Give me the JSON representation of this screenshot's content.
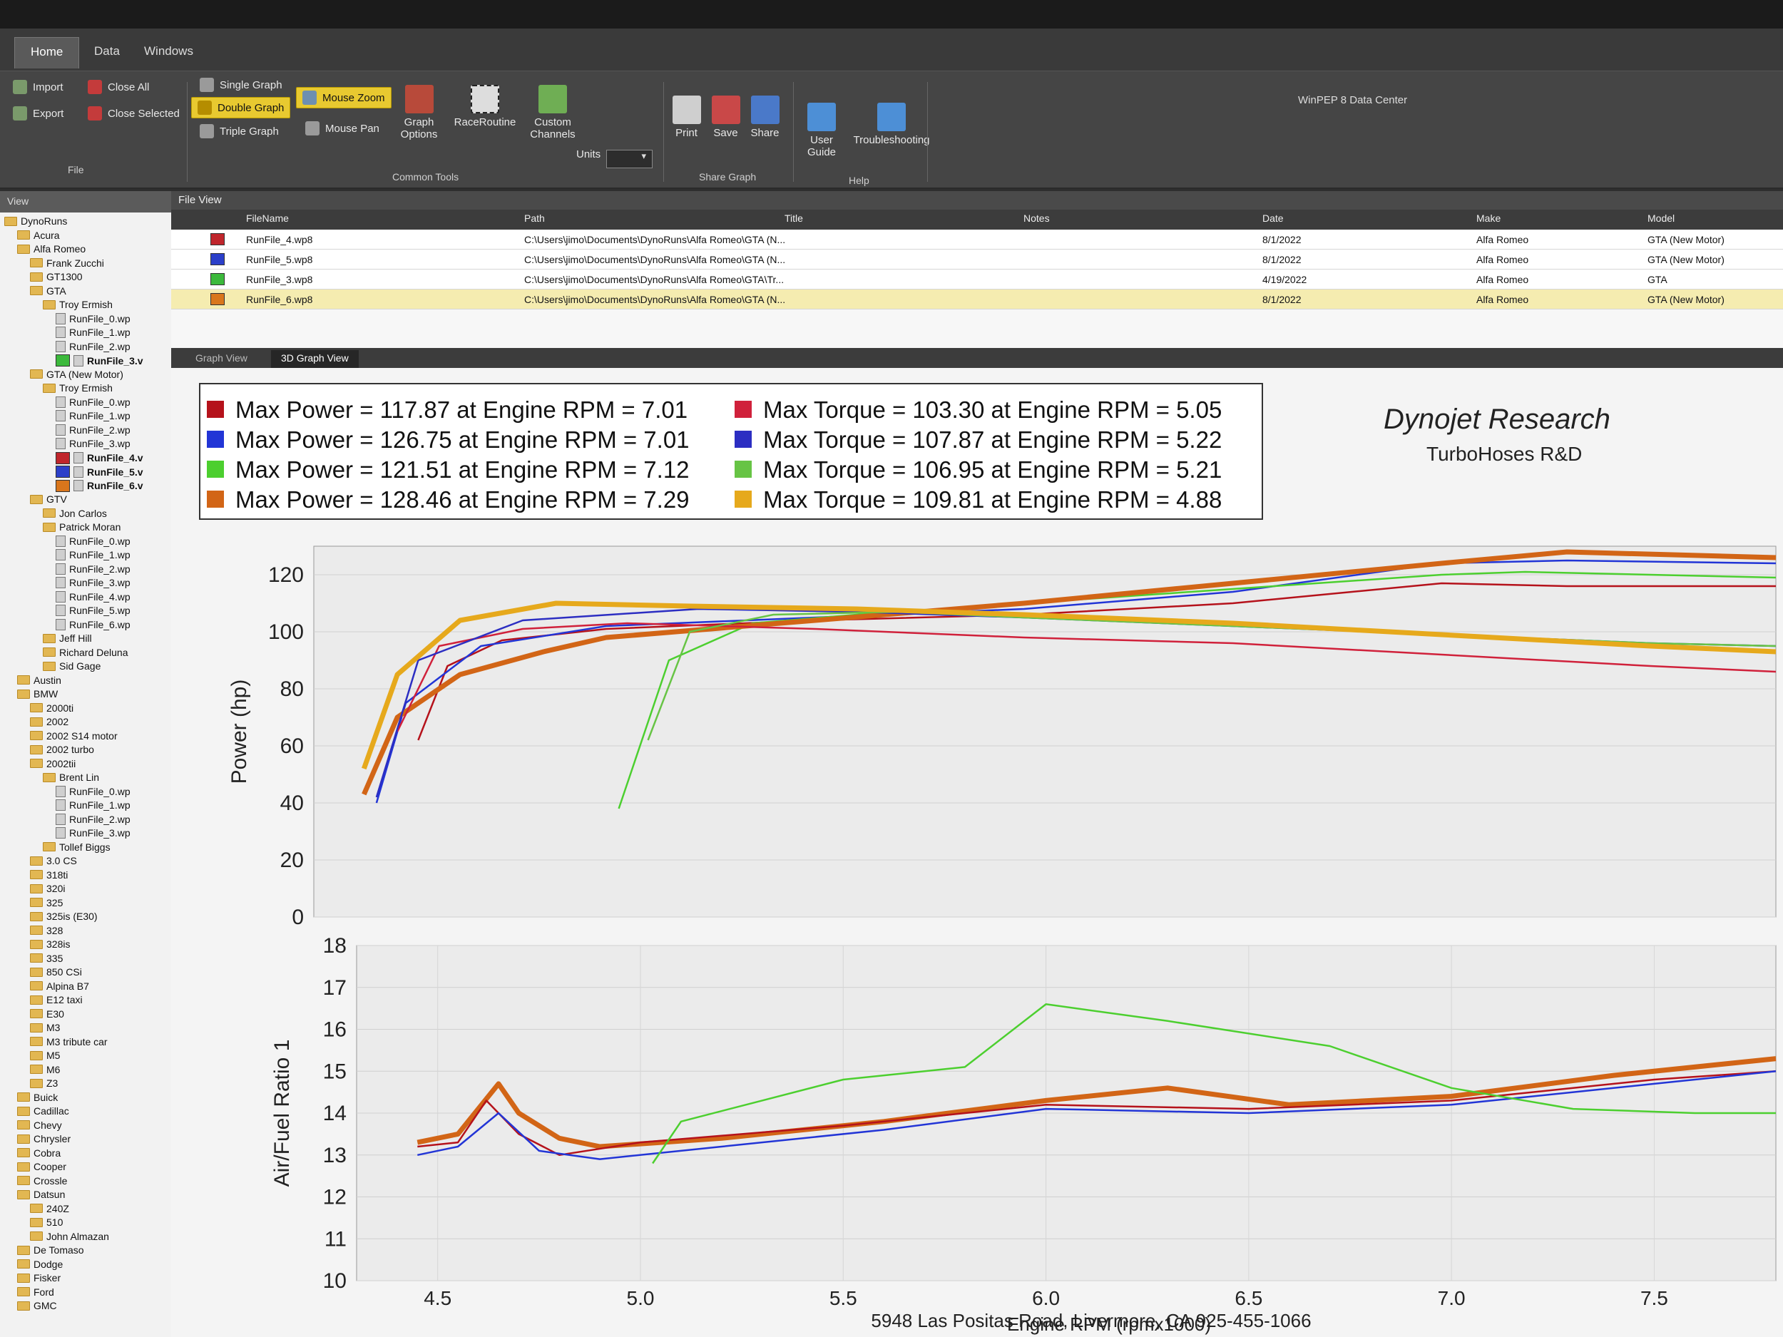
{
  "app": {
    "title": "WinPEP 8 Data Center",
    "tabs": [
      "Home",
      "Data",
      "Windows"
    ],
    "ribbon": {
      "file": {
        "import": "Import",
        "export": "Export",
        "close_all": "Close All",
        "close_selected": "Close Selected",
        "label": "File"
      },
      "graphs": {
        "single": "Single Graph",
        "double": "Double Graph",
        "triple": "Triple Graph"
      },
      "mouse": {
        "zoom": "Mouse Zoom",
        "pan": "Mouse Pan"
      },
      "graph_options": "Graph Options",
      "race_routine": "RaceRoutine",
      "custom_channels": "Custom Channels",
      "units_label": "Units",
      "common_tools_label": "Common Tools",
      "share": {
        "print": "Print",
        "save": "Save",
        "share": "Share",
        "label": "Share Graph"
      },
      "help": {
        "user_guide": "User Guide",
        "troubleshooting": "Troubleshooting",
        "label": "Help"
      }
    }
  },
  "sidebar": {
    "header": "View",
    "tree": [
      {
        "text": "DynoRuns",
        "indent": 0,
        "kind": "root"
      },
      {
        "text": "Acura",
        "indent": 1,
        "kind": "folder"
      },
      {
        "text": "Alfa Romeo",
        "indent": 1,
        "kind": "folder"
      },
      {
        "text": "Frank Zucchi",
        "indent": 2,
        "kind": "folder"
      },
      {
        "text": "GT1300",
        "indent": 2,
        "kind": "folder"
      },
      {
        "text": "GTA",
        "indent": 2,
        "kind": "folder"
      },
      {
        "text": "Troy Ermish",
        "indent": 3,
        "kind": "folder"
      },
      {
        "text": "RunFile_0.wp",
        "indent": 4,
        "kind": "file"
      },
      {
        "text": "RunFile_1.wp",
        "indent": 4,
        "kind": "file"
      },
      {
        "text": "RunFile_2.wp",
        "indent": 4,
        "kind": "file"
      },
      {
        "text": "RunFile_3.v",
        "indent": 4,
        "kind": "file-bold",
        "swatch": "#3cb93c"
      },
      {
        "text": "GTA (New Motor)",
        "indent": 2,
        "kind": "folder"
      },
      {
        "text": "Troy Ermish",
        "indent": 3,
        "kind": "folder"
      },
      {
        "text": "RunFile_0.wp",
        "indent": 4,
        "kind": "file"
      },
      {
        "text": "RunFile_1.wp",
        "indent": 4,
        "kind": "file"
      },
      {
        "text": "RunFile_2.wp",
        "indent": 4,
        "kind": "file"
      },
      {
        "text": "RunFile_3.wp",
        "indent": 4,
        "kind": "file"
      },
      {
        "text": "RunFile_4.v",
        "indent": 4,
        "kind": "file-bold",
        "swatch": "#c0262c"
      },
      {
        "text": "RunFile_5.v",
        "indent": 4,
        "kind": "file-bold",
        "swatch": "#2b3fc9"
      },
      {
        "text": "RunFile_6.v",
        "indent": 4,
        "kind": "file-bold",
        "swatch": "#d9761c"
      },
      {
        "text": "GTV",
        "indent": 2,
        "kind": "folder"
      },
      {
        "text": "Jon Carlos",
        "indent": 3,
        "kind": "folder"
      },
      {
        "text": "Patrick Moran",
        "indent": 3,
        "kind": "folder"
      },
      {
        "text": "RunFile_0.wp",
        "indent": 4,
        "kind": "file"
      },
      {
        "text": "RunFile_1.wp",
        "indent": 4,
        "kind": "file"
      },
      {
        "text": "RunFile_2.wp",
        "indent": 4,
        "kind": "file"
      },
      {
        "text": "RunFile_3.wp",
        "indent": 4,
        "kind": "file"
      },
      {
        "text": "RunFile_4.wp",
        "indent": 4,
        "kind": "file"
      },
      {
        "text": "RunFile_5.wp",
        "indent": 4,
        "kind": "file"
      },
      {
        "text": "RunFile_6.wp",
        "indent": 4,
        "kind": "file"
      },
      {
        "text": "Jeff Hill",
        "indent": 3,
        "kind": "folder"
      },
      {
        "text": "Richard Deluna",
        "indent": 3,
        "kind": "folder"
      },
      {
        "text": "Sid Gage",
        "indent": 3,
        "kind": "folder"
      },
      {
        "text": "Austin",
        "indent": 1,
        "kind": "folder"
      },
      {
        "text": "BMW",
        "indent": 1,
        "kind": "folder"
      },
      {
        "text": "2000ti",
        "indent": 2,
        "kind": "folder"
      },
      {
        "text": "2002",
        "indent": 2,
        "kind": "folder"
      },
      {
        "text": "2002 S14 motor",
        "indent": 2,
        "kind": "folder"
      },
      {
        "text": "2002 turbo",
        "indent": 2,
        "kind": "folder"
      },
      {
        "text": "2002tii",
        "indent": 2,
        "kind": "folder"
      },
      {
        "text": "Brent Lin",
        "indent": 3,
        "kind": "folder"
      },
      {
        "text": "RunFile_0.wp",
        "indent": 4,
        "kind": "file"
      },
      {
        "text": "RunFile_1.wp",
        "indent": 4,
        "kind": "file"
      },
      {
        "text": "RunFile_2.wp",
        "indent": 4,
        "kind": "file"
      },
      {
        "text": "RunFile_3.wp",
        "indent": 4,
        "kind": "file"
      },
      {
        "text": "Tollef Biggs",
        "indent": 3,
        "kind": "folder"
      },
      {
        "text": "3.0 CS",
        "indent": 2,
        "kind": "folder"
      },
      {
        "text": "318ti",
        "indent": 2,
        "kind": "folder"
      },
      {
        "text": "320i",
        "indent": 2,
        "kind": "folder"
      },
      {
        "text": "325",
        "indent": 2,
        "kind": "folder"
      },
      {
        "text": "325is (E30)",
        "indent": 2,
        "kind": "folder"
      },
      {
        "text": "328",
        "indent": 2,
        "kind": "folder"
      },
      {
        "text": "328is",
        "indent": 2,
        "kind": "folder"
      },
      {
        "text": "335",
        "indent": 2,
        "kind": "folder"
      },
      {
        "text": "850 CSi",
        "indent": 2,
        "kind": "folder"
      },
      {
        "text": "Alpina B7",
        "indent": 2,
        "kind": "folder"
      },
      {
        "text": "E12 taxi",
        "indent": 2,
        "kind": "folder"
      },
      {
        "text": "E30",
        "indent": 2,
        "kind": "folder"
      },
      {
        "text": "M3",
        "indent": 2,
        "kind": "folder"
      },
      {
        "text": "M3 tribute car",
        "indent": 2,
        "kind": "folder"
      },
      {
        "text": "M5",
        "indent": 2,
        "kind": "folder"
      },
      {
        "text": "M6",
        "indent": 2,
        "kind": "folder"
      },
      {
        "text": "Z3",
        "indent": 2,
        "kind": "folder"
      },
      {
        "text": "Buick",
        "indent": 1,
        "kind": "folder"
      },
      {
        "text": "Cadillac",
        "indent": 1,
        "kind": "folder"
      },
      {
        "text": "Chevy",
        "indent": 1,
        "kind": "folder"
      },
      {
        "text": "Chrysler",
        "indent": 1,
        "kind": "folder"
      },
      {
        "text": "Cobra",
        "indent": 1,
        "kind": "folder"
      },
      {
        "text": "Cooper",
        "indent": 1,
        "kind": "folder"
      },
      {
        "text": "Crossle",
        "indent": 1,
        "kind": "folder"
      },
      {
        "text": "Datsun",
        "indent": 1,
        "kind": "folder"
      },
      {
        "text": "240Z",
        "indent": 2,
        "kind": "folder"
      },
      {
        "text": "510",
        "indent": 2,
        "kind": "folder"
      },
      {
        "text": "John Almazan",
        "indent": 2,
        "kind": "folder"
      },
      {
        "text": "De Tomaso",
        "indent": 1,
        "kind": "folder"
      },
      {
        "text": "Dodge",
        "indent": 1,
        "kind": "folder"
      },
      {
        "text": "Fisker",
        "indent": 1,
        "kind": "folder"
      },
      {
        "text": "Ford",
        "indent": 1,
        "kind": "folder"
      },
      {
        "text": "GMC",
        "indent": 1,
        "kind": "folder"
      }
    ]
  },
  "file_view": {
    "title": "File View",
    "columns": [
      "FileName",
      "Path",
      "Title",
      "Notes",
      "Date",
      "Make",
      "Model"
    ],
    "rows": [
      {
        "color": "#c0262c",
        "file": "RunFile_4.wp8",
        "path": "C:\\Users\\jimo\\Documents\\DynoRuns\\Alfa Romeo\\GTA (N...",
        "title": "",
        "notes": "",
        "date": "8/1/2022",
        "make": "Alfa Romeo",
        "model": "GTA (New Motor)"
      },
      {
        "color": "#2b3fc9",
        "file": "RunFile_5.wp8",
        "path": "C:\\Users\\jimo\\Documents\\DynoRuns\\Alfa Romeo\\GTA (N...",
        "title": "",
        "notes": "",
        "date": "8/1/2022",
        "make": "Alfa Romeo",
        "model": "GTA (New Motor)"
      },
      {
        "color": "#3cb93c",
        "file": "RunFile_3.wp8",
        "path": "C:\\Users\\jimo\\Documents\\DynoRuns\\Alfa Romeo\\GTA\\Tr...",
        "title": "",
        "notes": "",
        "date": "4/19/2022",
        "make": "Alfa Romeo",
        "model": "GTA"
      },
      {
        "color": "#d9761c",
        "file": "RunFile_6.wp8",
        "path": "C:\\Users\\jimo\\Documents\\DynoRuns\\Alfa Romeo\\GTA (N...",
        "title": "",
        "notes": "",
        "date": "8/1/2022",
        "make": "Alfa Romeo",
        "model": "GTA (New Motor)",
        "selected": true
      }
    ]
  },
  "graph_view": {
    "tabs": [
      "Graph View",
      "3D Graph View"
    ],
    "brand": "Dynojet Research",
    "subtitle": "TurboHoses R&D",
    "footer": "5948 Las Positas Road, Livermore, CA 925-455-1066",
    "legend": [
      {
        "text": "Max Power = 117.87 at Engine RPM = 7.01",
        "color": "#b5121b"
      },
      {
        "text": "Max Power = 126.75 at Engine RPM = 7.01",
        "color": "#2235d6"
      },
      {
        "text": "Max Power = 121.51 at Engine RPM = 7.12",
        "color": "#4ccf2f"
      },
      {
        "text": "Max Power = 128.46 at Engine RPM = 7.29",
        "color": "#d26516"
      },
      {
        "text": "Max Torque = 103.30 at Engine RPM = 5.05",
        "color": "#d0213b"
      },
      {
        "text": "Max Torque = 107.87 at Engine RPM = 5.22",
        "color": "#2c2ec2"
      },
      {
        "text": "Max Torque = 106.95 at Engine RPM = 5.21",
        "color": "#67c445"
      },
      {
        "text": "Max Torque = 109.81 at Engine RPM = 4.88",
        "color": "#e6a91c"
      }
    ]
  },
  "chart_data": [
    {
      "type": "line",
      "ylabel": "Power (hp)",
      "ylim": [
        0,
        130
      ],
      "xlim": [
        4.3,
        7.8
      ],
      "yticks": [
        0,
        20,
        40,
        60,
        80,
        100,
        120
      ],
      "grid": true,
      "series": [
        {
          "color": "#b5121b",
          "x": [
            4.55,
            4.62,
            4.75,
            5.0,
            5.5,
            6.0,
            6.5,
            7.0,
            7.3,
            7.8
          ],
          "y": [
            62,
            88,
            97,
            101,
            104,
            106,
            110,
            117,
            116,
            116
          ]
        },
        {
          "color": "#2235d6",
          "x": [
            4.45,
            4.52,
            4.7,
            5.0,
            5.5,
            6.0,
            6.5,
            7.0,
            7.3,
            7.8
          ],
          "y": [
            40,
            75,
            95,
            102,
            105,
            108,
            114,
            124,
            125,
            124
          ]
        },
        {
          "color": "#4ccf2f",
          "x": [
            5.03,
            5.15,
            5.35,
            5.6,
            6.0,
            6.5,
            7.0,
            7.2,
            7.8
          ],
          "y": [
            38,
            90,
            103,
            106,
            110,
            115,
            120,
            121,
            119
          ]
        },
        {
          "color": "#d26516",
          "x": [
            4.42,
            4.5,
            4.65,
            4.85,
            5.0,
            5.5,
            6.0,
            6.5,
            7.0,
            7.3,
            7.8
          ],
          "y": [
            43,
            70,
            85,
            93,
            98,
            104,
            110,
            117,
            124,
            128,
            126
          ]
        },
        {
          "color": "#d0213b",
          "x": [
            4.5,
            4.6,
            4.8,
            5.05,
            5.5,
            6.0,
            6.5,
            7.0,
            7.5,
            7.8
          ],
          "y": [
            65,
            95,
            101,
            103,
            101,
            98,
            96,
            92,
            88,
            86
          ]
        },
        {
          "color": "#2c2ec2",
          "x": [
            4.45,
            4.55,
            4.8,
            5.22,
            5.6,
            6.0,
            6.5,
            7.0,
            7.5,
            7.8
          ],
          "y": [
            42,
            90,
            104,
            108,
            107,
            105,
            102,
            99,
            96,
            95
          ]
        },
        {
          "color": "#67c445",
          "x": [
            5.1,
            5.2,
            5.4,
            5.7,
            6.0,
            6.5,
            7.0,
            7.5,
            7.8
          ],
          "y": [
            62,
            100,
            106,
            107,
            105,
            102,
            99,
            96,
            95
          ]
        },
        {
          "color": "#e6a91c",
          "x": [
            4.42,
            4.5,
            4.65,
            4.88,
            5.2,
            5.6,
            6.0,
            6.5,
            7.0,
            7.5,
            7.8
          ],
          "y": [
            52,
            85,
            104,
            110,
            109,
            108,
            106,
            103,
            99,
            95,
            93
          ]
        }
      ]
    },
    {
      "type": "line",
      "xlabel": "Engine RPM (rpmx1000)",
      "ylabel": "Air/Fuel Ratio 1",
      "ylim": [
        10,
        18
      ],
      "xlim": [
        4.3,
        7.8
      ],
      "yticks": [
        10,
        11,
        12,
        13,
        14,
        15,
        16,
        17,
        18
      ],
      "xticks": [
        4.5,
        5.0,
        5.5,
        6.0,
        6.5,
        7.0,
        7.5
      ],
      "grid": true,
      "series": [
        {
          "color": "#d26516",
          "x": [
            4.45,
            4.55,
            4.65,
            4.7,
            4.8,
            4.9,
            5.2,
            5.6,
            6.0,
            6.3,
            6.6,
            7.0,
            7.4,
            7.8
          ],
          "y": [
            13.3,
            13.5,
            14.7,
            14.0,
            13.4,
            13.2,
            13.4,
            13.8,
            14.3,
            14.6,
            14.2,
            14.4,
            14.9,
            15.3
          ]
        },
        {
          "color": "#b5121b",
          "x": [
            4.45,
            4.55,
            4.62,
            4.7,
            4.8,
            5.0,
            5.5,
            6.0,
            6.5,
            7.0,
            7.5,
            7.8
          ],
          "y": [
            13.2,
            13.3,
            14.3,
            13.5,
            13.0,
            13.3,
            13.7,
            14.2,
            14.1,
            14.3,
            14.8,
            15.0
          ]
        },
        {
          "color": "#2235d6",
          "x": [
            4.45,
            4.55,
            4.65,
            4.75,
            4.9,
            5.2,
            5.6,
            6.0,
            6.5,
            7.0,
            7.5,
            7.8
          ],
          "y": [
            13.0,
            13.2,
            14.0,
            13.1,
            12.9,
            13.2,
            13.6,
            14.1,
            14.0,
            14.2,
            14.7,
            15.0
          ]
        },
        {
          "color": "#4ccf2f",
          "x": [
            5.03,
            5.1,
            5.3,
            5.5,
            5.8,
            6.0,
            6.3,
            6.7,
            7.0,
            7.3,
            7.6,
            7.8
          ],
          "y": [
            12.8,
            13.8,
            14.3,
            14.8,
            15.1,
            16.6,
            16.2,
            15.6,
            14.6,
            14.1,
            14.0,
            14.0
          ]
        }
      ]
    }
  ]
}
